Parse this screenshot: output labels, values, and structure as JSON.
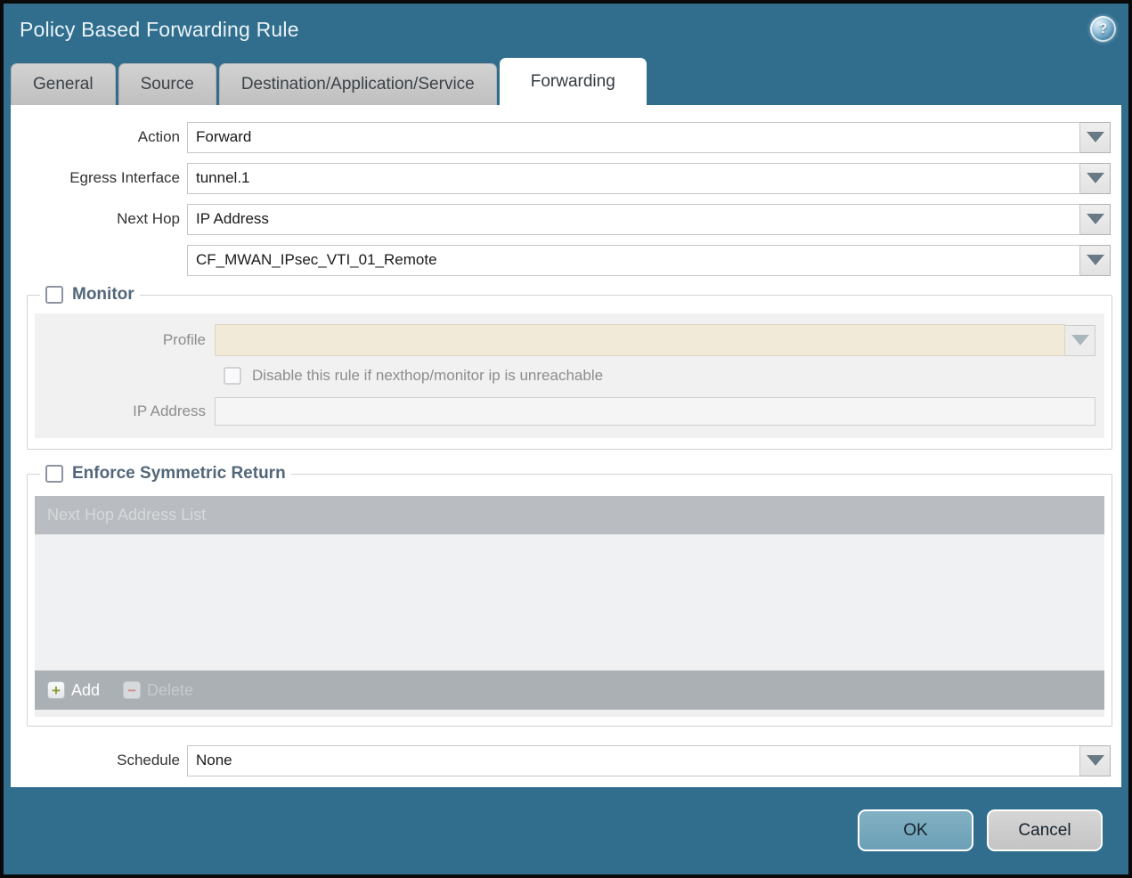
{
  "dialog": {
    "title": "Policy Based Forwarding Rule"
  },
  "tabs": [
    {
      "label": "General",
      "active": false
    },
    {
      "label": "Source",
      "active": false
    },
    {
      "label": "Destination/Application/Service",
      "active": false
    },
    {
      "label": "Forwarding",
      "active": true
    }
  ],
  "form": {
    "action": {
      "label": "Action",
      "value": "Forward"
    },
    "egress_interface": {
      "label": "Egress Interface",
      "value": "tunnel.1"
    },
    "next_hop": {
      "label": "Next Hop",
      "value": "IP Address"
    },
    "next_hop_address": {
      "value": "CF_MWAN_IPsec_VTI_01_Remote"
    },
    "schedule": {
      "label": "Schedule",
      "value": "None"
    }
  },
  "monitor": {
    "legend": "Monitor",
    "checked": false,
    "profile_label": "Profile",
    "profile_value": "",
    "disable_checkbox_label": "Disable this rule if nexthop/monitor ip is unreachable",
    "disable_checkbox_checked": false,
    "ip_address_label": "IP Address",
    "ip_address_value": ""
  },
  "symmetric_return": {
    "legend": "Enforce Symmetric Return",
    "checked": false,
    "table_header": "Next Hop Address List",
    "rows": [],
    "add_label": "Add",
    "delete_label": "Delete",
    "add_glyph": "+",
    "delete_glyph": "−"
  },
  "footer": {
    "ok_label": "OK",
    "cancel_label": "Cancel"
  },
  "icons": {
    "help": "help-icon",
    "dropdown": "chevron-down-icon",
    "add": "plus-icon",
    "delete": "minus-icon",
    "help_glyph": "?"
  },
  "colors": {
    "dialog_teal": "#316e8e",
    "active_tab_bg": "#ffffff",
    "inactive_tab_bg": "#c6c6c6",
    "disabled_panel": "#f1f1f1",
    "profile_field_beige": "#f1ead8",
    "table_header_gray": "#b9bdc1",
    "table_footer_gray": "#abb0b5",
    "ok_button": "#6ba0b6",
    "cancel_button": "#c9c9c9",
    "legend_text": "#53677a"
  }
}
